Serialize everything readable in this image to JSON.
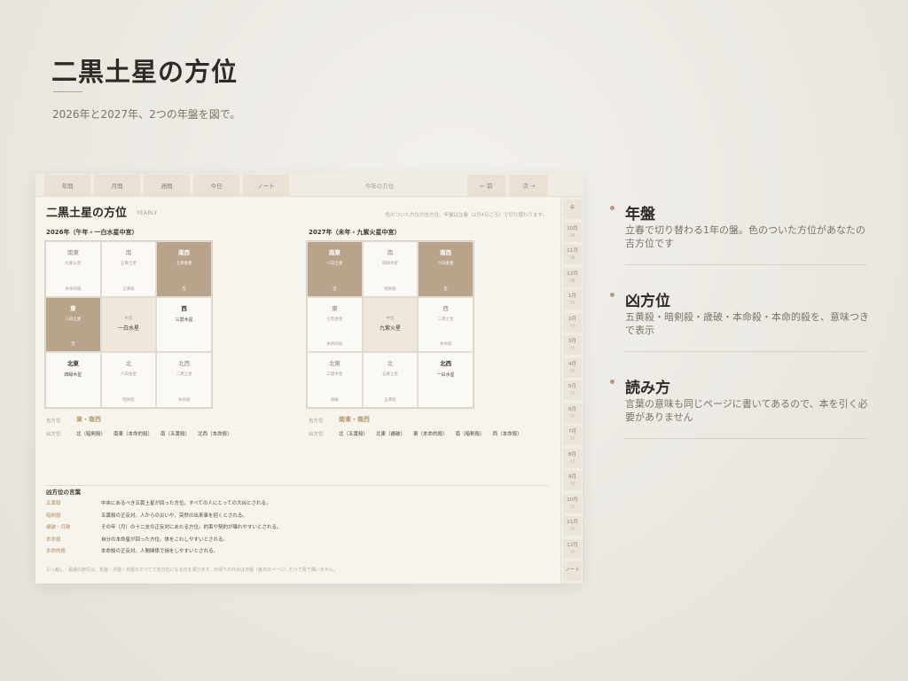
{
  "slide": {
    "title": "二黒土星の方位",
    "subtitle": "2026年と2027年、2つの年盤を図で。"
  },
  "planner": {
    "nav": {
      "items": [
        "年間",
        "月間",
        "週間",
        "今日",
        "ノート"
      ],
      "center_label": "今年の方位",
      "prev": "← 前",
      "next": "次 →"
    },
    "title": "二黒土星の方位",
    "badge": "YEARLY",
    "note": "色のついた方位が吉方位。年盤は立春（2月4日ごろ）で切り替わります。",
    "side_tabs": [
      {
        "label": "年",
        "sub": ""
      },
      {
        "label": "10月",
        "sub": "'26"
      },
      {
        "label": "11月",
        "sub": "'26"
      },
      {
        "label": "12月",
        "sub": "'26"
      },
      {
        "label": "1月",
        "sub": "'27"
      },
      {
        "label": "2月",
        "sub": "'27"
      },
      {
        "label": "3月",
        "sub": "'27"
      },
      {
        "label": "4月",
        "sub": "'27"
      },
      {
        "label": "5月",
        "sub": "'27"
      },
      {
        "label": "6月",
        "sub": "'27"
      },
      {
        "label": "7月",
        "sub": "'27"
      },
      {
        "label": "8月",
        "sub": "'27"
      },
      {
        "label": "9月",
        "sub": "'27"
      },
      {
        "label": "10月",
        "sub": "'27"
      },
      {
        "label": "11月",
        "sub": "'27"
      },
      {
        "label": "12月",
        "sub": "'27"
      },
      {
        "label": "ノート",
        "sub": ""
      }
    ],
    "charts": [
      {
        "heading": "2026年（午年・一白水星中宮）",
        "cells": [
          {
            "dir": "南東",
            "star": "九紫火星",
            "foot": "本命的殺",
            "style": "normal"
          },
          {
            "dir": "南",
            "star": "五黄土星",
            "foot": "五黄殺",
            "style": "normal"
          },
          {
            "dir": "南西",
            "star": "七赤金星",
            "foot": "吉",
            "style": "bad"
          },
          {
            "dir": "東",
            "star": "八白土星",
            "foot": "吉",
            "style": "bad"
          },
          {
            "dir": "中宮",
            "star": "一白水星",
            "foot": "",
            "style": "center"
          },
          {
            "dir": "西",
            "star": "三碧木星",
            "foot": "",
            "style": "normal-strong"
          },
          {
            "dir": "北東",
            "star": "四緑木星",
            "foot": "",
            "style": "normal-strong"
          },
          {
            "dir": "北",
            "star": "六白金星",
            "foot": "暗剣殺",
            "style": "normal"
          },
          {
            "dir": "北西",
            "star": "二黒土星",
            "foot": "本命殺",
            "style": "normal"
          }
        ],
        "lucky_label": "吉方位",
        "lucky": "東・南西",
        "unlucky_label": "凶方位",
        "unlucky": [
          "北（暗剣殺）",
          "南東（本命的殺）",
          "南（五黄殺）",
          "北西（本命殺）"
        ]
      },
      {
        "heading": "2027年（未年・九紫火星中宮）",
        "cells": [
          {
            "dir": "南東",
            "star": "八白土星",
            "foot": "吉",
            "style": "bad"
          },
          {
            "dir": "南",
            "star": "四緑木星",
            "foot": "暗剣殺",
            "style": "normal"
          },
          {
            "dir": "南西",
            "star": "六白金星",
            "foot": "吉",
            "style": "bad"
          },
          {
            "dir": "東",
            "star": "七赤金星",
            "foot": "本命的殺",
            "style": "normal"
          },
          {
            "dir": "中宮",
            "star": "九紫火星",
            "foot": "",
            "style": "center"
          },
          {
            "dir": "西",
            "star": "二黒土星",
            "foot": "本命殺",
            "style": "normal"
          },
          {
            "dir": "北東",
            "star": "三碧木星",
            "foot": "歳破",
            "style": "normal"
          },
          {
            "dir": "北",
            "star": "五黄土星",
            "foot": "五黄殺",
            "style": "normal"
          },
          {
            "dir": "北西",
            "star": "一白水星",
            "foot": "",
            "style": "normal-strong"
          }
        ],
        "lucky_label": "吉方位",
        "lucky": "南東・南西",
        "unlucky_label": "凶方位",
        "unlucky": [
          "北（五黄殺）",
          "北東（歳破）",
          "東（本命的殺）",
          "南（暗剣殺）",
          "西（本命殺）"
        ]
      }
    ],
    "glossary": {
      "heading": "凶方位の言葉",
      "rows": [
        {
          "term": "五黄殺",
          "def": "中央にあるべき五黄土星が回った方位。すべての人にとっての大凶とされる。"
        },
        {
          "term": "暗剣殺",
          "def": "五黄殺の正反対。人からの災いや、突然の出来事を招くとされる。"
        },
        {
          "term": "歳破・月破",
          "def": "その年（月）の十二支の正反対にあたる方位。約束や契約が壊れやすいとされる。"
        },
        {
          "term": "本命殺",
          "def": "自分の本命星が回った方位。体をこわしやすいとされる。"
        },
        {
          "term": "本命的殺",
          "def": "本命殺の正反対。人間関係で損をしやすいとされる。"
        }
      ]
    },
    "footer": "引っ越し・長期の旅行は、年盤・月盤・日盤のすべてで吉方位になる日を選びます。日帰りの外出は日盤（各日のページ）だけで見て構いません。"
  },
  "features": [
    {
      "heading": "年盤",
      "desc": "立春で切り替わる1年の盤。色のついた方位があなたの吉方位です"
    },
    {
      "heading": "凶方位",
      "desc": "五黄殺・暗剣殺・歳破・本命殺・本命的殺を、意味つきで表示"
    },
    {
      "heading": "読み方",
      "desc": "言葉の意味も同じページに書いてあるので、本を引く必要がありません"
    }
  ],
  "colors": {
    "accent": "#b9a38b",
    "center": "#efe7dc",
    "lucky_text": "#b7976d"
  }
}
